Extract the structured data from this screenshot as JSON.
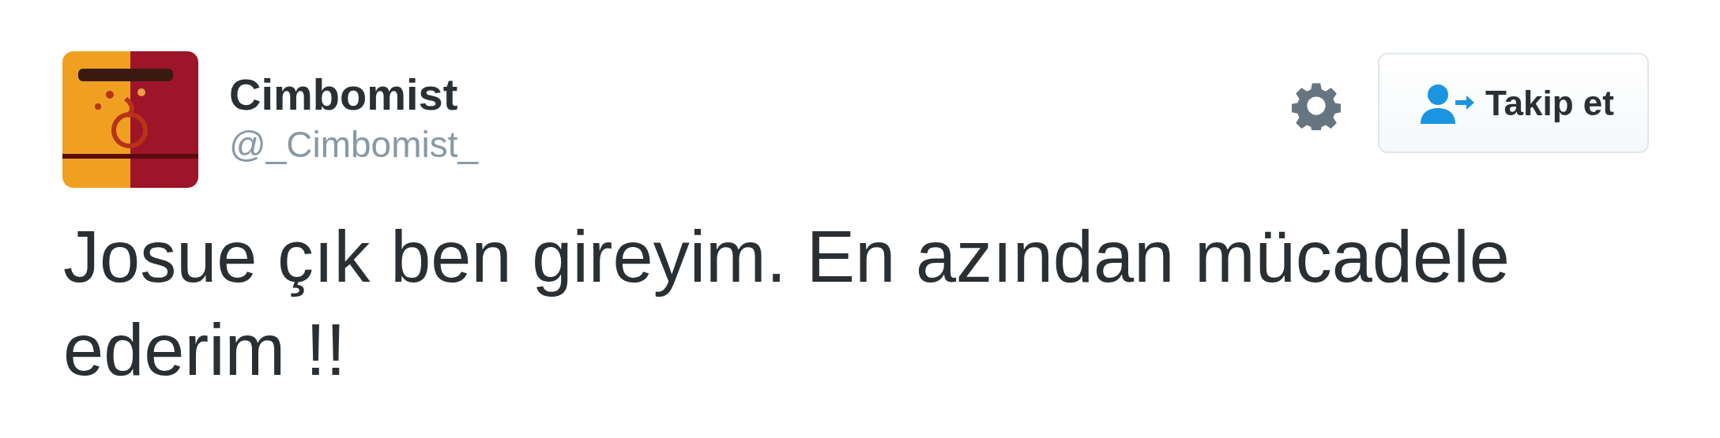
{
  "author": {
    "name": "Cimbomist",
    "handle": "@_Cimbomist_"
  },
  "follow_button": {
    "label": "Takip et"
  },
  "tweet": {
    "text": "Josue çık ben gireyim. En azından mücadele ederim !!"
  }
}
